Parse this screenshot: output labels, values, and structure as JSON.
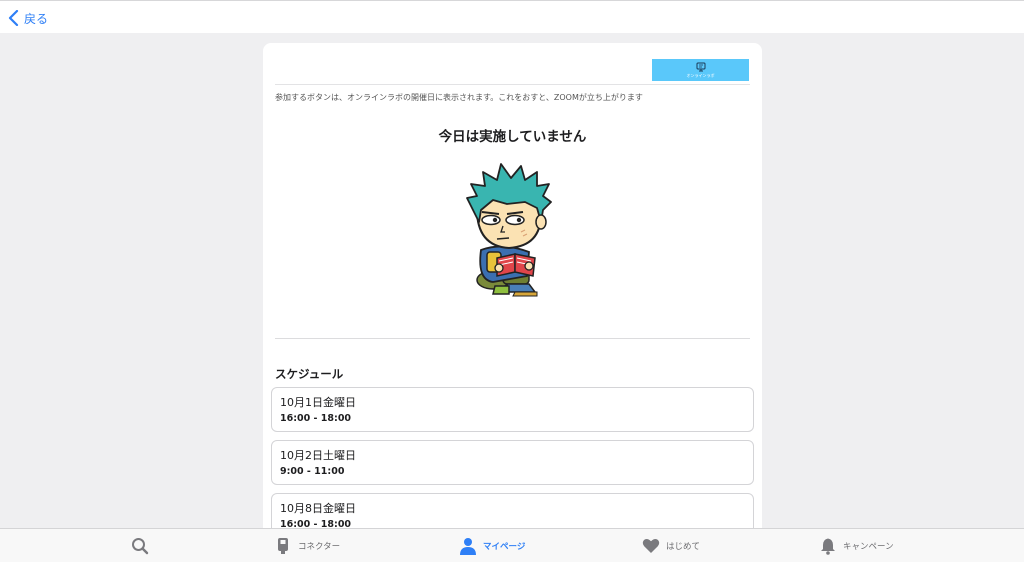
{
  "header": {
    "back_label": "戻る",
    "back_icon": "chevron-left-icon"
  },
  "card": {
    "lab_button_label": "オンラインラボ",
    "lab_button_icon": "online-lab-icon",
    "notice": "参加するボタンは、オンラインラボの開催日に表示されます。これをおすと、ZOOMが立ち上がります",
    "headline": "今日は実施していません",
    "schedule_title": "スケジュール",
    "schedule": [
      {
        "date": "10月1日金曜日",
        "time": "16:00 - 18:00"
      },
      {
        "date": "10月2日土曜日",
        "time": "9:00 - 11:00"
      },
      {
        "date": "10月8日金曜日",
        "time": "16:00 - 18:00"
      }
    ]
  },
  "tabbar": {
    "items": [
      {
        "label": "",
        "icon": "search-icon"
      },
      {
        "label": "コネクター",
        "icon": "connector-icon"
      },
      {
        "label": "マイページ",
        "icon": "person-icon",
        "active": true
      },
      {
        "label": "はじめて",
        "icon": "heart-icon"
      },
      {
        "label": "キャンペーン",
        "icon": "bell-icon"
      }
    ]
  },
  "colors": {
    "accent": "#2e7ff6",
    "lab_button": "#5ac8fa",
    "background": "#efeff1"
  }
}
